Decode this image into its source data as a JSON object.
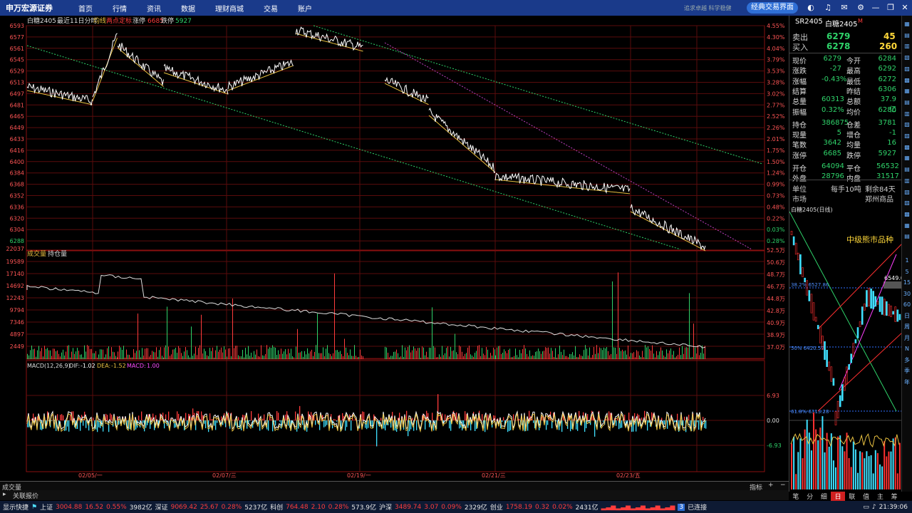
{
  "app": {
    "logo": "申万宏源证券",
    "tagline": "追求卓越 科学稳健",
    "classic_button": "经典交易界面"
  },
  "menu": [
    "首页",
    "行情",
    "资讯",
    "数据",
    "理财商城",
    "交易",
    "账户"
  ],
  "top_icons": [
    "theme-icon",
    "headset-icon",
    "mail-icon",
    "gear-icon",
    "minimize-icon",
    "restore-icon",
    "close-icon"
  ],
  "chart_header": {
    "name": "白糖2405",
    "period": "最近11日分时",
    "avg": "均线",
    "two_point": "两点定标",
    "limit_up_label": "涨停",
    "limit_up": "6685",
    "limit_down_label": "跌停",
    "limit_down": "5927"
  },
  "price_ticks": [
    "6593",
    "6577",
    "6561",
    "6545",
    "6529",
    "6513",
    "6497",
    "6481",
    "6465",
    "6449",
    "6433",
    "6416",
    "6400",
    "6384",
    "6368",
    "6352",
    "6336",
    "6320",
    "6304",
    "6288"
  ],
  "pct_ticks": [
    "4.55%",
    "4.30%",
    "4.04%",
    "3.79%",
    "3.53%",
    "3.28%",
    "3.02%",
    "2.77%",
    "2.52%",
    "2.26%",
    "2.01%",
    "1.75%",
    "1.50%",
    "1.24%",
    "0.99%",
    "0.73%",
    "0.48%",
    "0.22%",
    "0.03%",
    "0.28%"
  ],
  "volume_header": {
    "vol": "成交量",
    "oi": "持仓量",
    "top": "22037"
  },
  "vol_ticks": [
    "19589",
    "17140",
    "14692",
    "12243",
    "9794",
    "7346",
    "4897",
    "2449"
  ],
  "oi_ticks": [
    "52.5万",
    "50.6万",
    "48.7万",
    "46.7万",
    "44.8万",
    "42.8万",
    "40.9万",
    "38.9万",
    "37.0万"
  ],
  "macd_header": {
    "title": "MACD(12,26,9)",
    "dif_label": "DIF:",
    "dif": "-1.02",
    "dea_label": "DEA:",
    "dea": "-1.52",
    "macd_label": "MACD:",
    "macd": "1.00"
  },
  "macd_ticks": [
    "6.93",
    "0.00",
    "-6.93"
  ],
  "date_labels": [
    "02/05/一",
    "02/07/三",
    "02/19/一",
    "02/21/三",
    "02/23/五"
  ],
  "bottom": {
    "indicator_label": "成交量",
    "related": "关联报价",
    "indicator": "指标"
  },
  "quote": {
    "code": "SR2405",
    "name": "白糖2405",
    "flag": "M",
    "sell_label": "卖出",
    "sell_price": "6279",
    "sell_vol": "45",
    "buy_label": "买入",
    "buy_price": "6278",
    "buy_vol": "260",
    "rows": [
      [
        "现价",
        "6279",
        "今开",
        "6284"
      ],
      [
        "涨跌",
        "-27",
        "最高",
        "6292"
      ],
      [
        "涨幅",
        "-0.43%",
        "最低",
        "6272"
      ],
      [
        "结算",
        "",
        "昨结",
        "6306"
      ],
      [
        "总量",
        "60313",
        "总额",
        "37.9亿"
      ],
      [
        "振幅",
        "0.32%",
        "均价",
        "6280"
      ],
      [
        "持仓",
        "386875",
        "仓差",
        "3781"
      ],
      [
        "现量",
        "5",
        "增仓",
        "-1"
      ],
      [
        "笔数",
        "3642",
        "均量",
        "16"
      ],
      [
        "涨停",
        "6685",
        "跌停",
        "5927"
      ],
      [
        "开仓",
        "64094",
        "平仓",
        "56532"
      ],
      [
        "外盘",
        "28796",
        "内盘",
        "31517"
      ]
    ],
    "unit_label": "单位",
    "unit": "每手10吨",
    "remain": "剩余84天",
    "market_label": "市场",
    "market": "郑州商品"
  },
  "daily": {
    "title": "白糖2405(日线)",
    "note": "中级熊市品种",
    "fib1": "38.2% 6527.86",
    "fib2": "50% 6420.57",
    "fib3": "61.8% 6313.28",
    "price_tag": "6549.0"
  },
  "daily_tabs": [
    "笔",
    "分",
    "细",
    "日",
    "联",
    "值",
    "主",
    "筹"
  ],
  "side_icons": [
    "1",
    "5",
    "15",
    "30",
    "60",
    "日",
    "周",
    "月",
    "N",
    "多",
    "季",
    "年"
  ],
  "status": {
    "show": "显示快捷",
    "sh_label": "上证",
    "sh": "3004.88",
    "sh_chg": "16.52",
    "sh_pct": "0.55%",
    "sh_amt": "3982亿",
    "sz_label": "深证",
    "sz": "9069.42",
    "sz_chg": "25.67",
    "sz_pct": "0.28%",
    "sz_amt": "5237亿",
    "kc_label": "科创",
    "kc": "764.48",
    "kc_chg": "2.10",
    "kc_pct": "0.28%",
    "kc_amt": "573.9亿",
    "hs_label": "沪深",
    "hs": "3489.74",
    "hs_chg": "3.07",
    "hs_pct": "0.09%",
    "hs_amt": "2329亿",
    "cy_label": "创业",
    "cy": "1758.19",
    "cy_chg": "0.32",
    "cy_pct": "0.02%",
    "cy_amt": "2431亿",
    "conn_num": "3",
    "conn": "已连接",
    "time": "21:39:06"
  },
  "colors": {
    "grid": "#8a1010",
    "price": "#ffffff",
    "avg": "#e8c040",
    "up": "#ff3c3c",
    "down": "#2fd36a",
    "macd_neg": "#3fe0ff"
  }
}
